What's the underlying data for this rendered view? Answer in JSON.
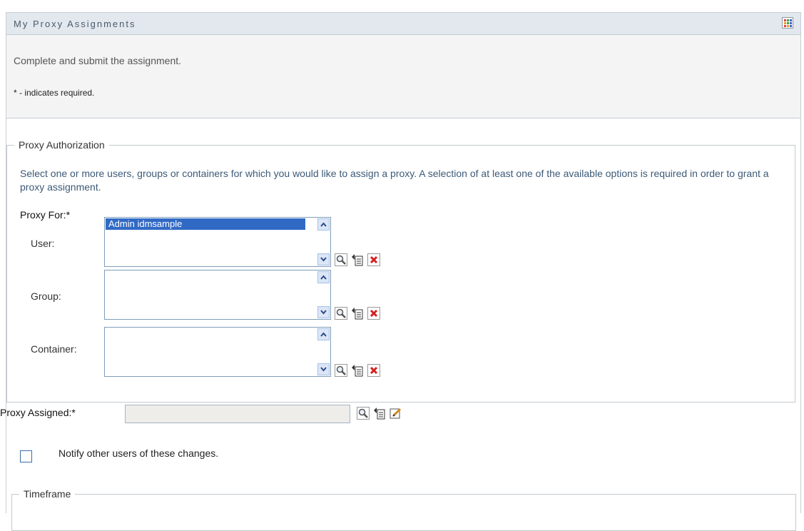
{
  "header": {
    "title": "My Proxy Assignments"
  },
  "intro": {
    "instruction": "Complete and submit the assignment.",
    "required_note": "* - indicates required."
  },
  "proxy_authorization": {
    "legend": "Proxy Authorization",
    "description": "Select one or more users, groups or containers for which you would like to assign a proxy. A selection of at least one of the available options is required in order to grant a proxy assignment.",
    "proxy_for_label": "Proxy For:*",
    "user": {
      "label": "User:",
      "items": [
        "Admin idmsample"
      ]
    },
    "group": {
      "label": "Group:",
      "items": []
    },
    "container": {
      "label": "Container:",
      "items": []
    }
  },
  "proxy_assigned": {
    "label": "Proxy Assigned:*",
    "value": ""
  },
  "notify": {
    "label": "Notify other users of these changes.",
    "checked": false
  },
  "timeframe": {
    "legend": "Timeframe"
  },
  "icons": {
    "search": "magnifier-icon",
    "history": "history-list-icon",
    "clear": "clear-x-icon",
    "edit": "edit-pencil-icon"
  },
  "colors": {
    "selection": "#316ac5",
    "header_bg": "#e2e8ee",
    "clear_red": "#d42020"
  }
}
